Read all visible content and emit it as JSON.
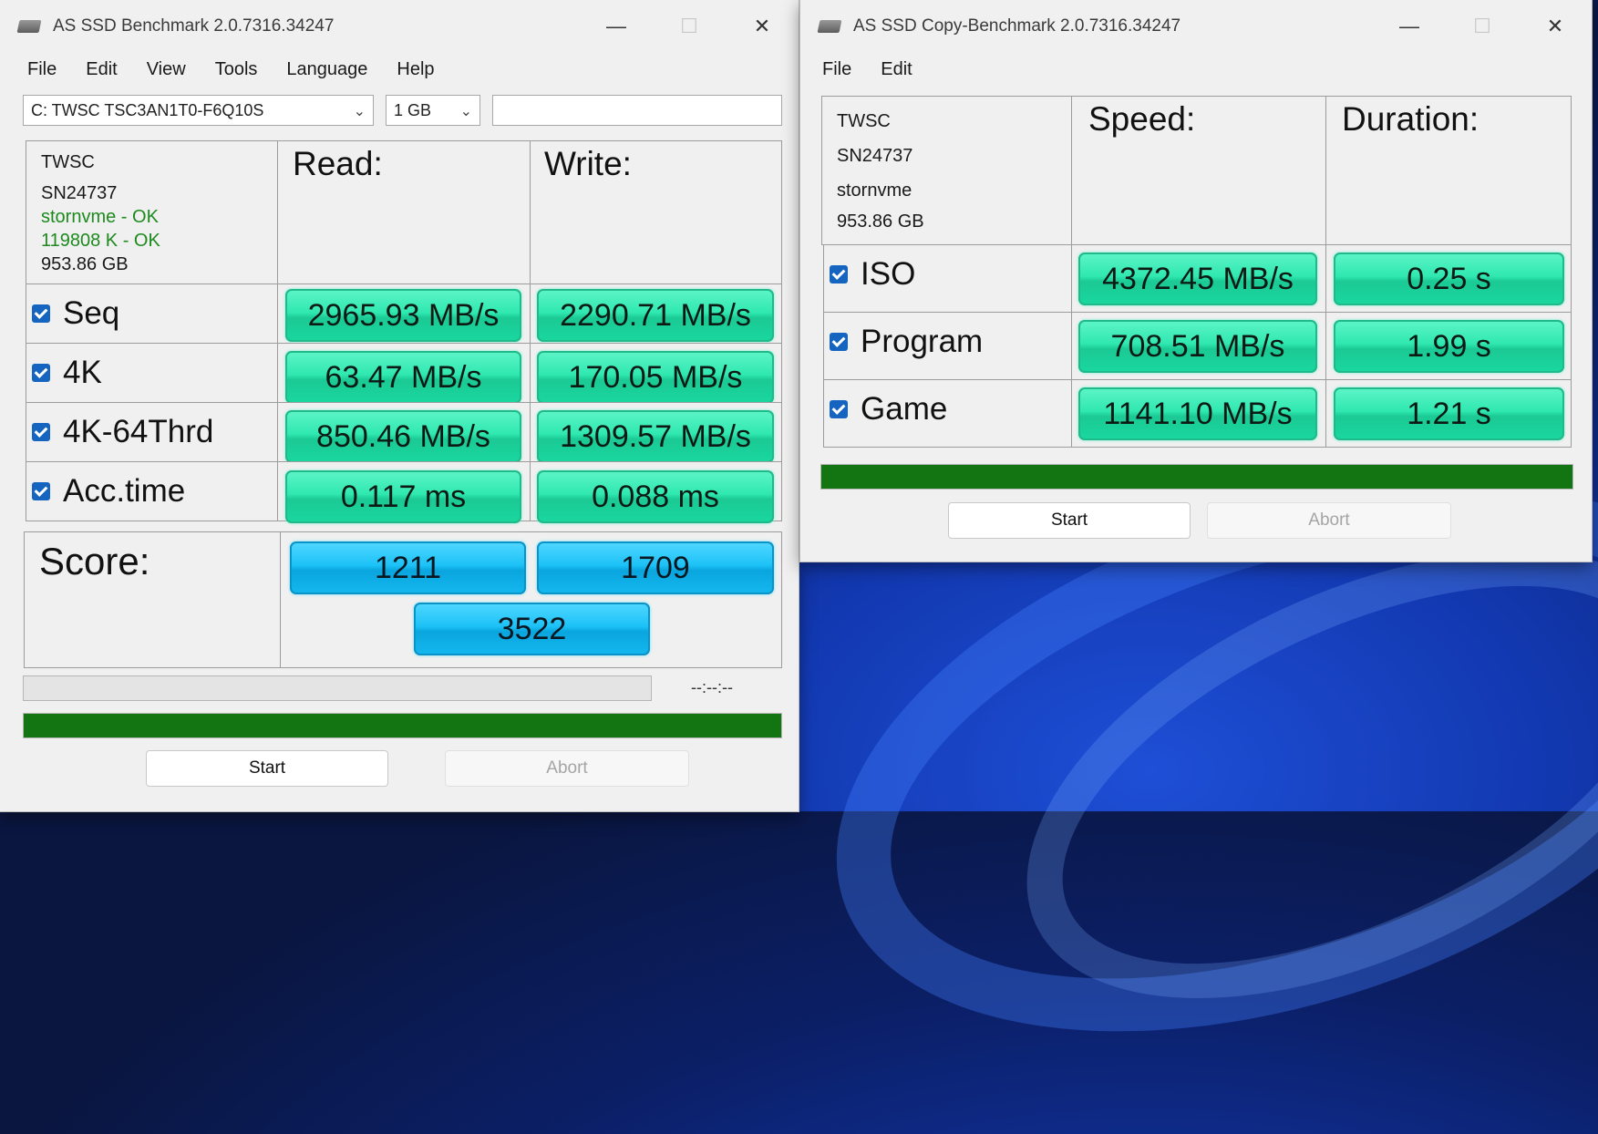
{
  "bench": {
    "title": "AS SSD Benchmark 2.0.7316.34247",
    "menu": [
      "File",
      "Edit",
      "View",
      "Tools",
      "Language",
      "Help"
    ],
    "drive_select": "C: TWSC TSC3AN1T0-F6Q10S",
    "size_select": "1 GB",
    "info": {
      "model": "TWSC",
      "serial": "SN24737",
      "driver": "stornvme - OK",
      "align": "119808 K - OK",
      "capacity": "953.86 GB"
    },
    "headers": {
      "read": "Read:",
      "write": "Write:",
      "score": "Score:"
    },
    "rows": [
      {
        "label": "Seq",
        "read": "2965.93 MB/s",
        "write": "2290.71 MB/s"
      },
      {
        "label": "4K",
        "read": "63.47 MB/s",
        "write": "170.05 MB/s"
      },
      {
        "label": "4K-64Thrd",
        "read": "850.46 MB/s",
        "write": "1309.57 MB/s"
      },
      {
        "label": "Acc.time",
        "read": "0.117 ms",
        "write": "0.088 ms"
      }
    ],
    "score": {
      "read": "1211",
      "write": "1709",
      "total": "3522"
    },
    "time_display": "--:--:--",
    "progress_total": 1.0,
    "start_label": "Start",
    "abort_label": "Abort"
  },
  "copy": {
    "title": "AS SSD Copy-Benchmark 2.0.7316.34247",
    "menu": [
      "File",
      "Edit"
    ],
    "info": {
      "model": "TWSC",
      "serial": "SN24737",
      "driver": "stornvme",
      "capacity": "953.86 GB"
    },
    "headers": {
      "speed": "Speed:",
      "duration": "Duration:"
    },
    "rows": [
      {
        "label": "ISO",
        "speed": "4372.45 MB/s",
        "duration": "0.25 s"
      },
      {
        "label": "Program",
        "speed": "708.51 MB/s",
        "duration": "1.99 s"
      },
      {
        "label": "Game",
        "speed": "1141.10 MB/s",
        "duration": "1.21 s"
      }
    ],
    "progress": 1.0,
    "start_label": "Start",
    "abort_label": "Abort"
  },
  "colors": {
    "value_green": "#2fe8b0",
    "score_blue": "#1cc2f7",
    "progress_green": "#127512",
    "ok_text": "#1d8a1d"
  }
}
